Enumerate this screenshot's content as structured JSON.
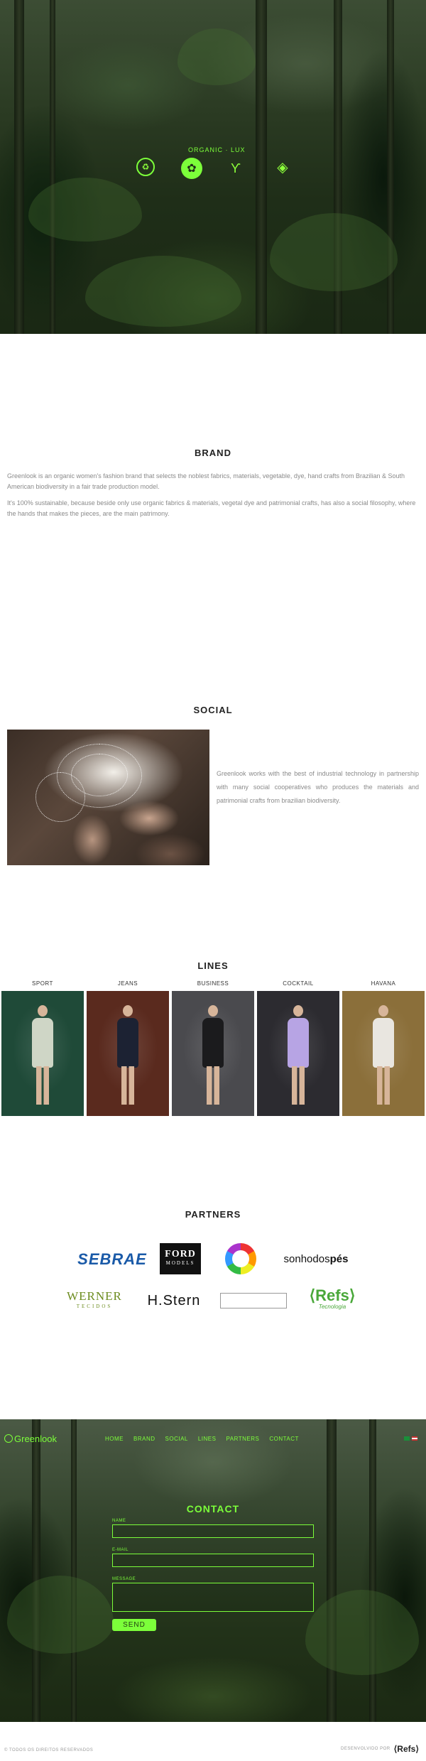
{
  "hero": {
    "tagline": "ORGANIC · LUX",
    "icons": [
      "organic-seal-icon",
      "flower-icon",
      "plant-icon",
      "diamond-icon"
    ],
    "accent_color": "#7cff3a"
  },
  "brand": {
    "title": "BRAND",
    "paragraph1": "Greenlook is an organic women's fashion brand that selects the noblest fabrics, materials, vegetable, dye, hand crafts from Brazilian & South American biodiversity in a fair trade production model.",
    "paragraph2": "It's 100% sustainable, because beside only use organic fabrics & materials, vegetal dye and patrimonial crafts, has also a social filosophy, where the hands that makes the pieces, are the main patrimony."
  },
  "social": {
    "title": "SOCIAL",
    "text": "Greenlook works with the best of industrial technology in partnership with many social cooperatives who produces the materials and patrimonial crafts from brazilian biodiversity."
  },
  "lines": {
    "title": "LINES",
    "items": [
      {
        "label": "SPORT",
        "bg": "#1f4a38",
        "outfit": "#cfd6c6"
      },
      {
        "label": "JEANS",
        "bg": "#5a2a1e",
        "outfit": "#1c2233"
      },
      {
        "label": "BUSINESS",
        "bg": "#4a4a4e",
        "outfit": "#1b1b1d"
      },
      {
        "label": "COCKTAIL",
        "bg": "#2c2b30",
        "outfit": "#b7a4e4"
      },
      {
        "label": "HAVANA",
        "bg": "#8b6f3a",
        "outfit": "#e9e6e0"
      }
    ]
  },
  "partners": {
    "title": "PARTNERS",
    "sebrae": "SEBRAE",
    "ford_line1": "FORD",
    "ford_line2": "MODELS",
    "sonho_regular": "sonhodos",
    "sonho_bold": "pés",
    "werner_line1": "WERNER",
    "werner_line2": "TECIDOS",
    "hstern": "H.Stern",
    "refs_line1": "⟨Refs⟩",
    "refs_line2": "Tecnologia"
  },
  "nav": {
    "logo": "Greenlook",
    "links": [
      "HOME",
      "BRAND",
      "SOCIAL",
      "LINES",
      "PARTNERS",
      "CONTACT"
    ]
  },
  "contact": {
    "title": "CONTACT",
    "name_label": "NAME",
    "email_label": "E-MAIL",
    "message_label": "MESSAGE",
    "name_value": "",
    "email_value": "",
    "message_value": "",
    "send_label": "SEND"
  },
  "footer": {
    "copyright": "© TODOS OS DIREITOS RESERVADOS",
    "developer_label": "DESENVOLVIDO POR",
    "developer_logo": "⟨Refs⟩"
  }
}
